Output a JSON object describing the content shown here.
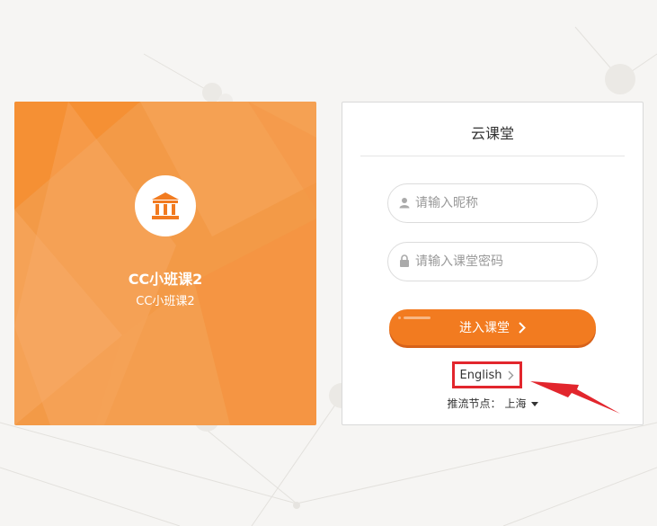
{
  "room": {
    "name": "CC小班课2",
    "desc": "CC小班课2",
    "icon": "building-icon"
  },
  "login": {
    "title": "云课堂",
    "nickname_placeholder": "请输入昵称",
    "password_placeholder": "请输入课堂密码",
    "enter_label": "进入课堂",
    "language_label": "English",
    "node_label": "推流节点：",
    "node_value": "上海"
  },
  "colors": {
    "accent": "#f27b20",
    "card": "#f39a47",
    "highlight": "#e2262d"
  }
}
